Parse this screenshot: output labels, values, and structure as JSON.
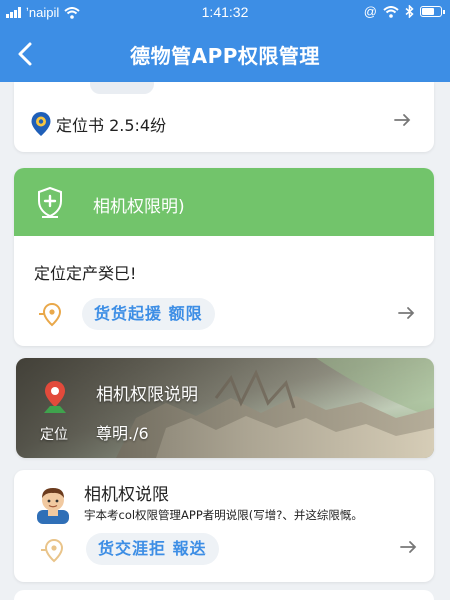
{
  "status_bar": {
    "carrier": "ʼnaipil",
    "time": "1:41:32",
    "icons": [
      "signal-icon",
      "wifi-icon",
      "at-icon",
      "wifi-icon",
      "bluetooth-icon",
      "battery-icon"
    ]
  },
  "nav": {
    "title": "德物管APP权限管理",
    "back_icon": "chevron-left-icon"
  },
  "colors": {
    "primary": "#3d8ee5",
    "green_banner": "#72c46b",
    "chip_bg": "#eef2f6"
  },
  "cards": {
    "location": {
      "label": "定位书 2.5:4纷",
      "icon": "location-pin-icon"
    },
    "camera": {
      "banner_title": "相机权限明)",
      "banner_icon": "shield-plus-icon",
      "subtitle": "定位定产癸巳!",
      "chip": "货货起援 额限",
      "chip_icon": "location-pin-icon"
    },
    "camera_explain": {
      "title": "相机权限说明",
      "sub": "尊明./6",
      "left_label": "定位",
      "icon": "map-pin-icon"
    },
    "explain": {
      "title": "相机权说限",
      "desc": "宇本考col权限管理APP者明说限(写增?、并这综限慨。",
      "chip": "货交涯拒 報迭",
      "avatar_icon": "avatar-icon",
      "chip_icon": "location-pin-icon"
    }
  },
  "arrow_icon": "arrow-right-icon"
}
